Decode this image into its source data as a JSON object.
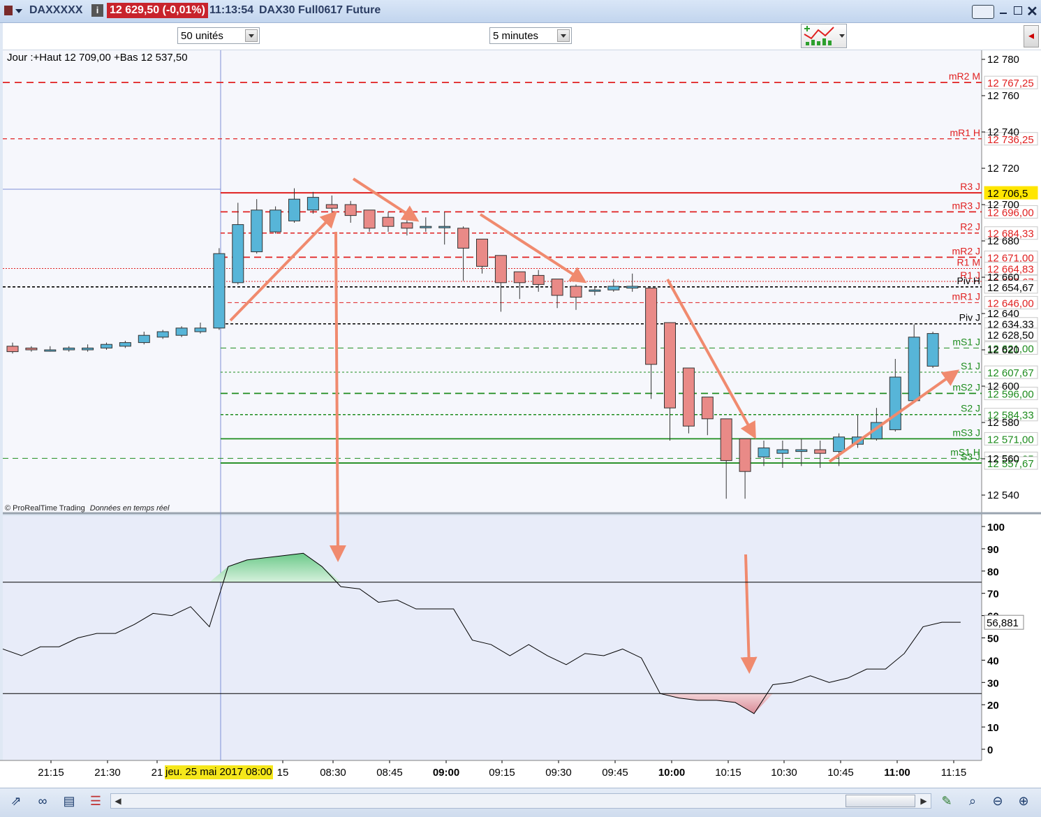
{
  "window": {
    "symbol": "DAXXXXX",
    "info_icon": "info-icon",
    "last_price": "12 629,50 (-0,01%)",
    "time": "11:13:54",
    "instrument": "DAX30 Full0617 Future"
  },
  "toolbar": {
    "units_value": "50 unités",
    "interval_value": "5 minutes"
  },
  "price_panel": {
    "header": "Jour :+Haut 12 709,00 +Bas 12 537,50",
    "footer_brand": "© ProRealTime Trading",
    "footer_data": "Données en temps réel",
    "current_price_tag": "12 706,5",
    "y_ticks": [
      "12 780",
      "12 760",
      "12 740",
      "12 720",
      "12 700",
      "12 680",
      "12 660",
      "12 640",
      "12 620",
      "12 600",
      "12 580",
      "12 560",
      "12 540"
    ],
    "levels": [
      {
        "label": "mR2 M",
        "value": "12 767,25",
        "color": "#e02020"
      },
      {
        "label": "mR1 H",
        "value": "12 736,25",
        "color": "#e02020"
      },
      {
        "label": "R3 J",
        "value": "12 706,5",
        "color": "#e02020"
      },
      {
        "label": "mR3 J",
        "value": "12 696,00",
        "color": "#e02020"
      },
      {
        "label": "R2 J",
        "value": "12 684,33",
        "color": "#e02020"
      },
      {
        "label": "mR2 J",
        "value": "12 671,00",
        "color": "#e02020"
      },
      {
        "label": "R1 M",
        "value": "12 664,83",
        "color": "#e02020"
      },
      {
        "label": "R1 J",
        "value": "12 657,67",
        "color": "#e02020"
      },
      {
        "label": "Piv H",
        "value": "12 654,67",
        "color": "#000000"
      },
      {
        "label": "mR1 J",
        "value": "12 646,00",
        "color": "#e02020"
      },
      {
        "label": "Piv J",
        "value": "12 634,33",
        "color": "#000000"
      },
      {
        "label": "",
        "value": "12 628,50",
        "color": "#000000"
      },
      {
        "label": "mS1 J",
        "value": "12 621,00",
        "color": "#1e8c1e"
      },
      {
        "label": "S1 J",
        "value": "12 607,67",
        "color": "#1e8c1e"
      },
      {
        "label": "mS2 J",
        "value": "12 596,00",
        "color": "#1e8c1e"
      },
      {
        "label": "S2 J",
        "value": "12 584,33",
        "color": "#1e8c1e"
      },
      {
        "label": "mS3 J",
        "value": "12 571,00",
        "color": "#1e8c1e"
      },
      {
        "label": "mS1 H",
        "value": "12 560,25",
        "color": "#1e8c1e"
      },
      {
        "label": "S3 J",
        "value": "12 557,67",
        "color": "#1e8c1e"
      }
    ]
  },
  "osc_panel": {
    "y_ticks": [
      "100",
      "90",
      "80",
      "70",
      "60",
      "50",
      "40",
      "30",
      "20",
      "10",
      "0"
    ],
    "current_value": "56,881"
  },
  "x_axis": {
    "date_label": "jeu. 25 mai 2017 08:00",
    "ticks": [
      "21:15",
      "21:30",
      "21",
      "15",
      "08:30",
      "08:45",
      "09:00",
      "09:15",
      "09:30",
      "09:45",
      "10:00",
      "10:15",
      "10:30",
      "10:45",
      "11:00",
      "11:15"
    ]
  },
  "chart_data": [
    {
      "type": "candlestick",
      "ylim": [
        12530,
        12785
      ],
      "candles": [
        {
          "o": 12622,
          "h": 12624,
          "l": 12618,
          "c": 12619
        },
        {
          "o": 12621,
          "h": 12622,
          "l": 12619,
          "c": 12620
        },
        {
          "o": 12620,
          "h": 12622,
          "l": 12619,
          "c": 12620
        },
        {
          "o": 12620,
          "h": 12622,
          "l": 12619,
          "c": 12621
        },
        {
          "o": 12620,
          "h": 12623,
          "l": 12619,
          "c": 12621
        },
        {
          "o": 12621,
          "h": 12624,
          "l": 12620,
          "c": 12623
        },
        {
          "o": 12622,
          "h": 12625,
          "l": 12621,
          "c": 12624
        },
        {
          "o": 12624,
          "h": 12630,
          "l": 12623,
          "c": 12628
        },
        {
          "o": 12627,
          "h": 12631,
          "l": 12626,
          "c": 12630
        },
        {
          "o": 12628,
          "h": 12633,
          "l": 12627,
          "c": 12632
        },
        {
          "o": 12630,
          "h": 12635,
          "l": 12629,
          "c": 12632
        },
        {
          "o": 12632,
          "h": 12676,
          "l": 12631,
          "c": 12673
        },
        {
          "o": 12657,
          "h": 12701,
          "l": 12656,
          "c": 12689
        },
        {
          "o": 12674,
          "h": 12703,
          "l": 12673,
          "c": 12697
        },
        {
          "o": 12685,
          "h": 12699,
          "l": 12684,
          "c": 12697
        },
        {
          "o": 12691,
          "h": 12709,
          "l": 12690,
          "c": 12703
        },
        {
          "o": 12697,
          "h": 12707,
          "l": 12695,
          "c": 12704
        },
        {
          "o": 12700,
          "h": 12705,
          "l": 12694,
          "c": 12698
        },
        {
          "o": 12700,
          "h": 12702,
          "l": 12690,
          "c": 12694
        },
        {
          "o": 12697,
          "h": 12697,
          "l": 12685,
          "c": 12687
        },
        {
          "o": 12693,
          "h": 12696,
          "l": 12685,
          "c": 12688
        },
        {
          "o": 12690,
          "h": 12696,
          "l": 12683,
          "c": 12687
        },
        {
          "o": 12688,
          "h": 12693,
          "l": 12685,
          "c": 12688
        },
        {
          "o": 12688,
          "h": 12696,
          "l": 12678,
          "c": 12688
        },
        {
          "o": 12687,
          "h": 12688,
          "l": 12658,
          "c": 12676
        },
        {
          "o": 12681,
          "h": 12681,
          "l": 12662,
          "c": 12666
        },
        {
          "o": 12672,
          "h": 12672,
          "l": 12641,
          "c": 12657
        },
        {
          "o": 12663,
          "h": 12663,
          "l": 12648,
          "c": 12657
        },
        {
          "o": 12661,
          "h": 12664,
          "l": 12652,
          "c": 12656
        },
        {
          "o": 12659,
          "h": 12659,
          "l": 12643,
          "c": 12650
        },
        {
          "o": 12655,
          "h": 12656,
          "l": 12642,
          "c": 12649
        },
        {
          "o": 12653,
          "h": 12655,
          "l": 12650,
          "c": 12653
        },
        {
          "o": 12653,
          "h": 12659,
          "l": 12652,
          "c": 12655
        },
        {
          "o": 12654,
          "h": 12662,
          "l": 12652,
          "c": 12655
        },
        {
          "o": 12654,
          "h": 12654,
          "l": 12593,
          "c": 12612
        },
        {
          "o": 12635,
          "h": 12635,
          "l": 12570,
          "c": 12588
        },
        {
          "o": 12610,
          "h": 12610,
          "l": 12574,
          "c": 12578
        },
        {
          "o": 12594,
          "h": 12594,
          "l": 12573,
          "c": 12582
        },
        {
          "o": 12582,
          "h": 12582,
          "l": 12538,
          "c": 12559
        },
        {
          "o": 12571,
          "h": 12571,
          "l": 12538,
          "c": 12553
        },
        {
          "o": 12561,
          "h": 12570,
          "l": 12556,
          "c": 12566
        },
        {
          "o": 12563,
          "h": 12570,
          "l": 12555,
          "c": 12565
        },
        {
          "o": 12564,
          "h": 12571,
          "l": 12556,
          "c": 12565
        },
        {
          "o": 12565,
          "h": 12570,
          "l": 12555,
          "c": 12563
        },
        {
          "o": 12564,
          "h": 12574,
          "l": 12556,
          "c": 12572
        },
        {
          "o": 12568,
          "h": 12584,
          "l": 12566,
          "c": 12572
        },
        {
          "o": 12571,
          "h": 12588,
          "l": 12570,
          "c": 12580
        },
        {
          "o": 12576,
          "h": 12615,
          "l": 12575,
          "c": 12605
        },
        {
          "o": 12592,
          "h": 12634,
          "l": 12591,
          "c": 12627
        },
        {
          "o": 12611,
          "h": 12630,
          "l": 12610,
          "c": 12629
        }
      ]
    },
    {
      "type": "line",
      "name": "",
      "ylim": [
        0,
        100
      ],
      "overbought": 75,
      "oversold": 25,
      "values": [
        45,
        42,
        46,
        46,
        50,
        52,
        52,
        56,
        61,
        60,
        64,
        55,
        82,
        85,
        86,
        87,
        88,
        82,
        73,
        72,
        66,
        67,
        63,
        63,
        63,
        49,
        47,
        42,
        47,
        42,
        38,
        43,
        42,
        45,
        41,
        25,
        23,
        22,
        22,
        21,
        16,
        29,
        30,
        33,
        30,
        32,
        36,
        36,
        43,
        55,
        57,
        57
      ]
    }
  ]
}
